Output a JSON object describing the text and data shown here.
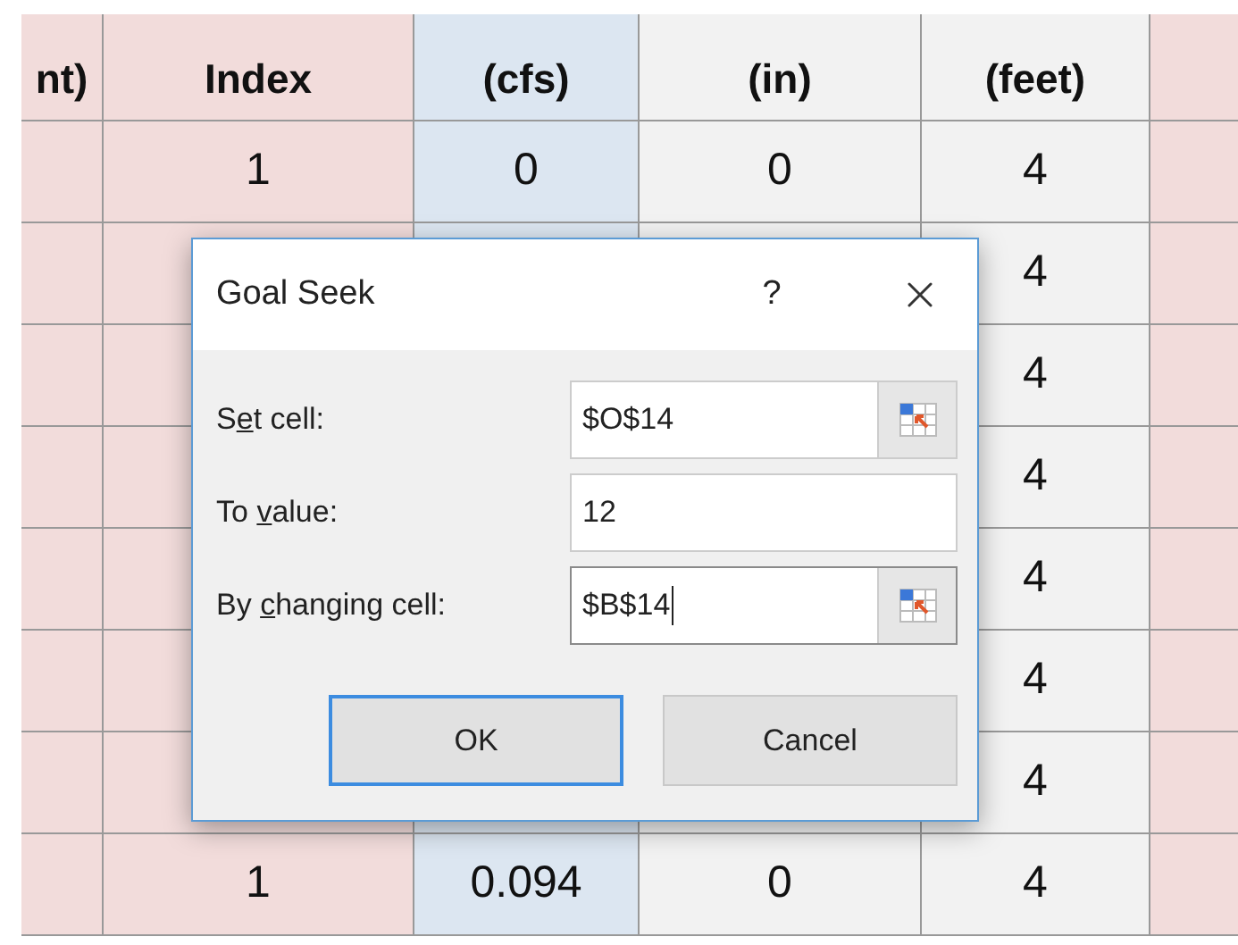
{
  "sheet": {
    "columns": [
      {
        "header_lines": [
          "nt)"
        ],
        "color": "#f2dcdb"
      },
      {
        "header_lines": [
          "Index"
        ],
        "color": "#f2dcdb"
      },
      {
        "header_lines": [
          "(cfs)"
        ],
        "color": "#dce6f1"
      },
      {
        "header_lines": [
          "(in)"
        ],
        "color": "#f2f2f2"
      },
      {
        "header_lines": [
          "(feet)"
        ],
        "color": "#f2f2f2"
      },
      {
        "color": "#f2dcdb"
      }
    ],
    "rows": [
      {
        "cells": [
          null,
          "1",
          "0",
          "0",
          "4",
          null
        ]
      },
      {
        "cells": [
          null,
          null,
          null,
          null,
          "4",
          null
        ]
      },
      {
        "cells": [
          null,
          null,
          null,
          null,
          "4",
          null
        ]
      },
      {
        "cells": [
          null,
          null,
          null,
          null,
          "4",
          null
        ]
      },
      {
        "cells": [
          null,
          null,
          null,
          null,
          "4",
          null
        ]
      },
      {
        "cells": [
          null,
          null,
          null,
          null,
          "4",
          null
        ]
      },
      {
        "cells": [
          null,
          null,
          null,
          null,
          "4",
          null
        ]
      },
      {
        "cells": [
          null,
          "1",
          "0.094",
          "0",
          "4",
          null
        ]
      }
    ]
  },
  "dialog": {
    "title": "Goal Seek",
    "help": "?",
    "fields": [
      {
        "kind": "reference",
        "label_before": "S",
        "access_key": "e",
        "label_after": "t cell:",
        "value": "$O$14",
        "focused": false
      },
      {
        "kind": "plain",
        "label_before": "To ",
        "access_key": "v",
        "label_after": "alue:",
        "value": "12",
        "focused": false
      },
      {
        "kind": "reference",
        "label_before": "By ",
        "access_key": "c",
        "label_after": "hanging cell:",
        "value": "$B$14",
        "focused": true
      }
    ],
    "buttons": [
      {
        "label": "OK",
        "default": true
      },
      {
        "label": "Cancel",
        "default": false
      }
    ]
  }
}
